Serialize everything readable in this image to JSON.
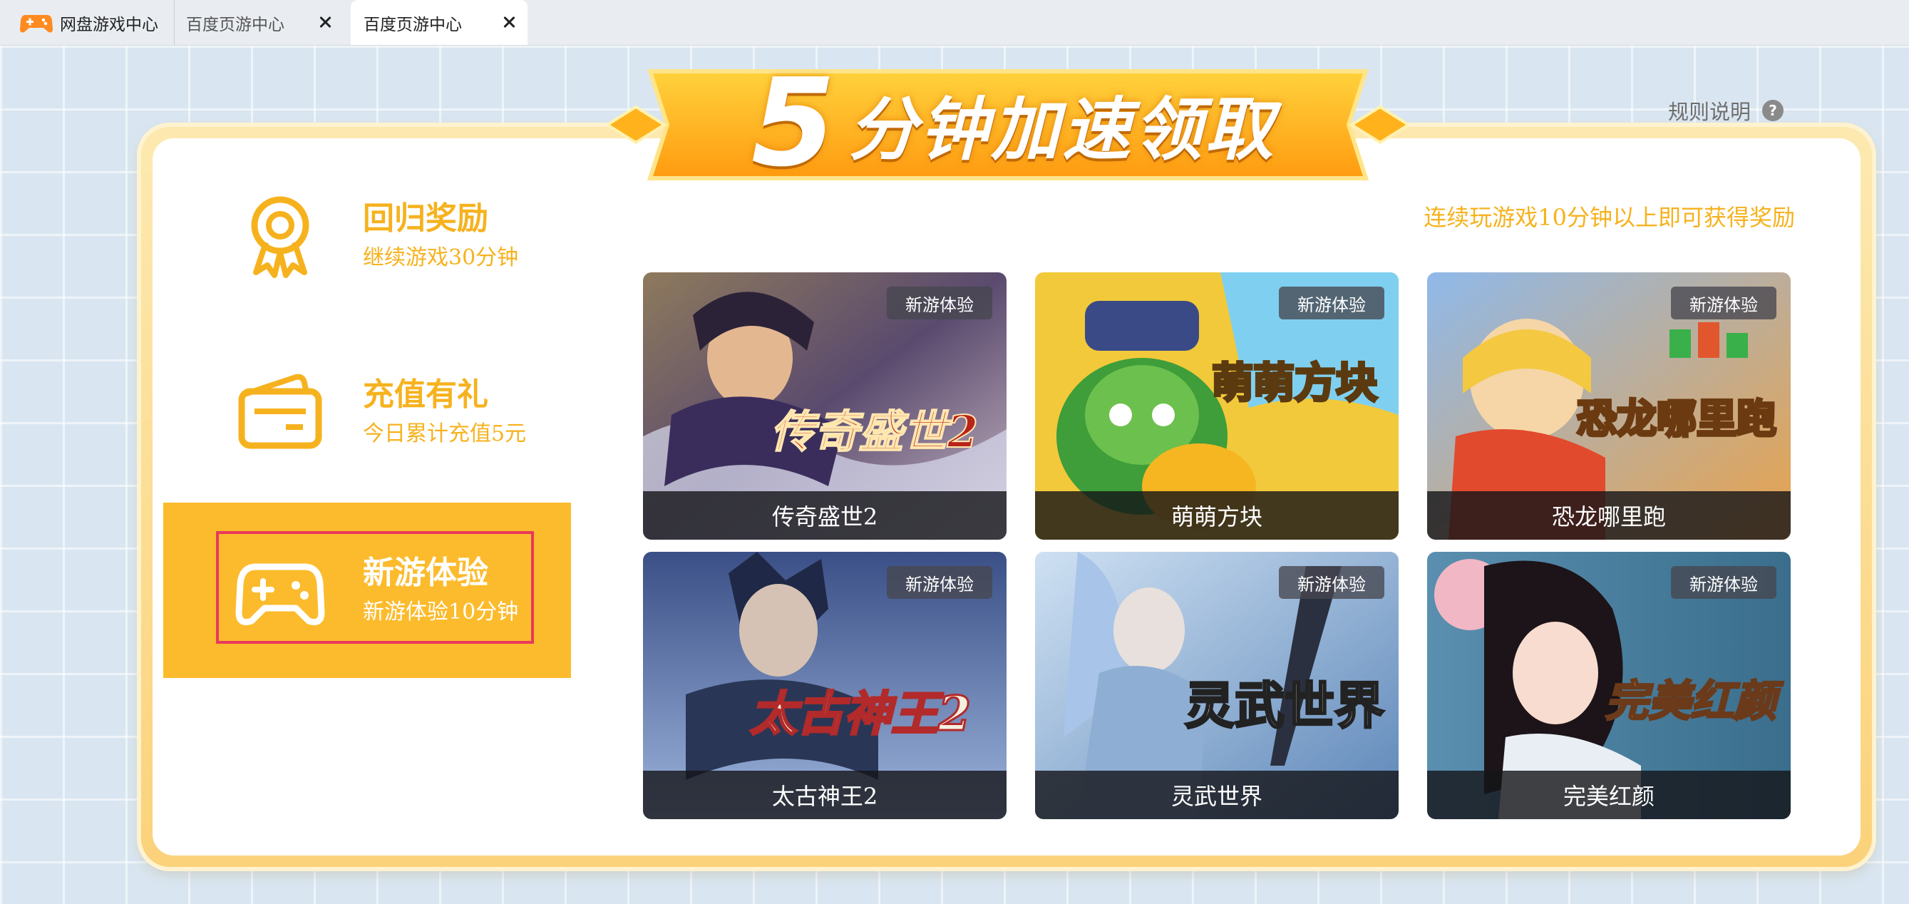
{
  "tabs": [
    {
      "label": "网盘游戏中心"
    },
    {
      "label": "百度页游中心"
    },
    {
      "label": "百度页游中心"
    }
  ],
  "header": {
    "banner_number": "5",
    "banner_text": "分钟加速领取",
    "rules_label": "规则说明",
    "rules_icon": "?",
    "tip": "连续玩游戏10分钟以上即可获得奖励"
  },
  "sidebar": {
    "items": [
      {
        "title": "回归奖励",
        "subtitle": "继续游戏30分钟",
        "icon": "award-ribbon-icon"
      },
      {
        "title": "充值有礼",
        "subtitle": "今日累计充值5元",
        "icon": "wallet-card-icon"
      },
      {
        "title": "新游体验",
        "subtitle": "新游体验10分钟",
        "icon": "gamepad-icon",
        "selected": true
      }
    ]
  },
  "games": [
    {
      "name": "传奇盛世2",
      "badge": "新游体验"
    },
    {
      "name": "萌萌方块",
      "badge": "新游体验"
    },
    {
      "name": "恐龙哪里跑",
      "badge": "新游体验"
    },
    {
      "name": "太古神王2",
      "badge": "新游体验"
    },
    {
      "name": "灵武世界",
      "badge": "新游体验"
    },
    {
      "name": "完美红颜",
      "badge": "新游体验"
    }
  ],
  "colors": {
    "accent": "#f6b21e",
    "selected_bg": "#fcbb2c",
    "highlight_border": "#e8395b"
  }
}
